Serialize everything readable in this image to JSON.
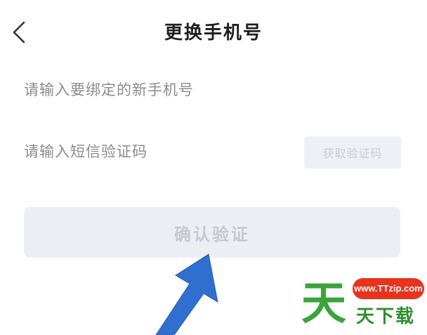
{
  "header": {
    "title": "更换手机号",
    "back_icon": "chevron-left-icon"
  },
  "form": {
    "phone_placeholder": "请输入要绑定的新手机号",
    "code_placeholder": "请输入短信验证码",
    "get_code_label": "获取验证码",
    "confirm_label": "确认验证"
  },
  "overlay": {
    "arrow_color": "#2f6fd0"
  },
  "watermark": {
    "site": "www.TTzip.com",
    "big_char": "天",
    "name": "天下载",
    "green": "#3aa43a",
    "red": "#e8331f"
  },
  "colors": {
    "disabled_bg": "#eceef4",
    "disabled_text": "#c5c8d0",
    "placeholder": "#8c8c8c",
    "title": "#1f1f1f"
  }
}
